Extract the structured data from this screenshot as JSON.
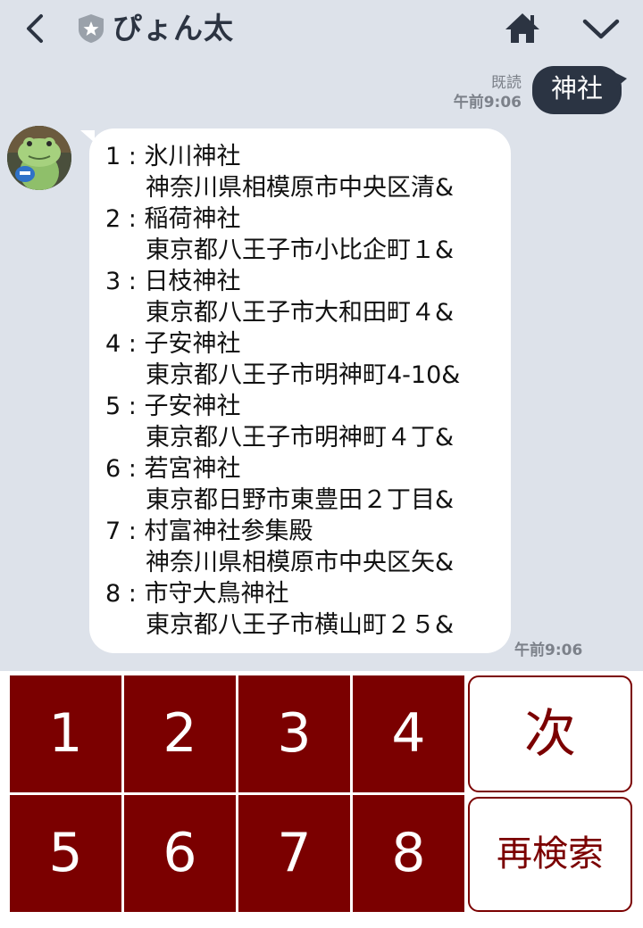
{
  "header": {
    "title": "ぴょん太"
  },
  "outgoing": {
    "read_label": "既読",
    "time": "午前9:06",
    "text": "神社"
  },
  "incoming": {
    "time": "午前9:06",
    "results": [
      {
        "label": "1 : 氷川神社",
        "address": "神奈川県相模原市中央区清&"
      },
      {
        "label": "2 : 稲荷神社",
        "address": "東京都八王子市小比企町１&"
      },
      {
        "label": "3 : 日枝神社",
        "address": "東京都八王子市大和田町４&"
      },
      {
        "label": "4 : 子安神社",
        "address": "東京都八王子市明神町4-10&"
      },
      {
        "label": "5 : 子安神社",
        "address": "東京都八王子市明神町４丁&"
      },
      {
        "label": "6 : 若宮神社",
        "address": "東京都日野市東豊田２丁目&"
      },
      {
        "label": "7 : 村富神社参集殿",
        "address": "神奈川県相模原市中央区矢&"
      },
      {
        "label": "8 : 市守大鳥神社",
        "address": "東京都八王子市横山町２５&"
      }
    ]
  },
  "keypad": {
    "numbers": [
      "1",
      "2",
      "3",
      "4",
      "5",
      "6",
      "7",
      "8"
    ],
    "next_label": "次",
    "research_label": "再検索"
  },
  "colors": {
    "background": "#dde2ea",
    "key_accent": "#7b0000",
    "outgoing_bubble": "#2b3443"
  }
}
